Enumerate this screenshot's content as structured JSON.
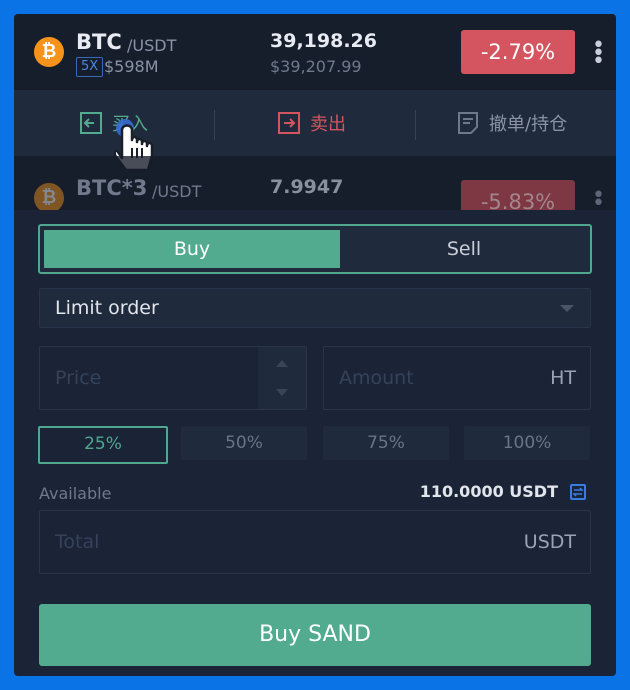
{
  "ticker_top": {
    "icon": "bitcoin-icon",
    "symbol": "BTC",
    "pair": "/USDT",
    "leverage": "5X",
    "volume": "$598M",
    "price": "39,198.26",
    "fiat_price": "$39,207.99",
    "change": "-2.79%",
    "change_color": "#d4555f"
  },
  "actions": {
    "buy_label": "买入",
    "sell_label": "卖出",
    "orders_label": "撤单/持仓"
  },
  "ticker_second": {
    "icon": "bitcoin-icon",
    "symbol": "BTC*3",
    "pair": "/USDT",
    "price": "7.9947",
    "change": "-5.83%"
  },
  "order_form": {
    "tab_buy": "Buy",
    "tab_sell": "Sell",
    "order_type": "Limit order",
    "price_placeholder": "Price",
    "amount_placeholder": "Amount",
    "amount_unit": "HT",
    "percentages": [
      "25%",
      "50%",
      "75%",
      "100%"
    ],
    "selected_percentage": "25%",
    "available_label": "Available",
    "available_value": "110.0000 USDT",
    "total_placeholder": "Total",
    "total_unit": "USDT",
    "submit_label": "Buy SAND"
  },
  "colors": {
    "accent_green": "#52ab8e",
    "negative_red": "#d4555f",
    "background": "#1b2536",
    "frame_blue": "#0a74e6"
  }
}
